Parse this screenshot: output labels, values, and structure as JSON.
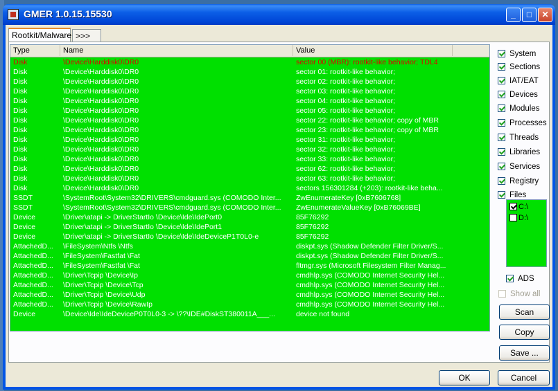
{
  "window": {
    "title": "GMER 1.0.15.15530",
    "minimize": "_",
    "maximize": "□",
    "close": "✕"
  },
  "tabs": [
    {
      "label": "Rootkit/Malware"
    },
    {
      "label": ">>>"
    }
  ],
  "columns": {
    "type": "Type",
    "name": "Name",
    "value": "Value"
  },
  "rows": [
    {
      "type": "Disk",
      "name": "\\Device\\Harddisk0\\DR0",
      "value": "sector 00 (MBR): rootkit-like behavior; TDL4",
      "highlight": true
    },
    {
      "type": "Disk",
      "name": "\\Device\\Harddisk0\\DR0",
      "value": "sector 01: rootkit-like behavior;"
    },
    {
      "type": "Disk",
      "name": "\\Device\\Harddisk0\\DR0",
      "value": "sector 02: rootkit-like behavior;"
    },
    {
      "type": "Disk",
      "name": "\\Device\\Harddisk0\\DR0",
      "value": "sector 03: rootkit-like behavior;"
    },
    {
      "type": "Disk",
      "name": "\\Device\\Harddisk0\\DR0",
      "value": "sector 04: rootkit-like behavior;"
    },
    {
      "type": "Disk",
      "name": "\\Device\\Harddisk0\\DR0",
      "value": "sector 05: rootkit-like behavior;"
    },
    {
      "type": "Disk",
      "name": "\\Device\\Harddisk0\\DR0",
      "value": "sector 22: rootkit-like behavior; copy of MBR"
    },
    {
      "type": "Disk",
      "name": "\\Device\\Harddisk0\\DR0",
      "value": "sector 23: rootkit-like behavior; copy of MBR"
    },
    {
      "type": "Disk",
      "name": "\\Device\\Harddisk0\\DR0",
      "value": "sector 31: rootkit-like behavior;"
    },
    {
      "type": "Disk",
      "name": "\\Device\\Harddisk0\\DR0",
      "value": "sector 32: rootkit-like behavior;"
    },
    {
      "type": "Disk",
      "name": "\\Device\\Harddisk0\\DR0",
      "value": "sector 33: rootkit-like behavior;"
    },
    {
      "type": "Disk",
      "name": "\\Device\\Harddisk0\\DR0",
      "value": "sector 62: rootkit-like behavior;"
    },
    {
      "type": "Disk",
      "name": "\\Device\\Harddisk0\\DR0",
      "value": "sector 63: rootkit-like behavior;"
    },
    {
      "type": "Disk",
      "name": "\\Device\\Harddisk0\\DR0",
      "value": "sectors 156301284 (+203): rootkit-like beha..."
    },
    {
      "type": "SSDT",
      "name": "\\SystemRoot\\System32\\DRIVERS\\cmdguard.sys (COMODO Inter...",
      "value": "ZwEnumerateKey [0xB7606768]"
    },
    {
      "type": "SSDT",
      "name": "\\SystemRoot\\System32\\DRIVERS\\cmdguard.sys (COMODO Inter...",
      "value": "ZwEnumerateValueKey [0xB76069BE]"
    },
    {
      "type": "Device",
      "name": "\\Driver\\atapi -> DriverStartIo \\Device\\Ide\\IdePort0",
      "value": "85F76292"
    },
    {
      "type": "Device",
      "name": "\\Driver\\atapi -> DriverStartIo \\Device\\Ide\\IdePort1",
      "value": "85F76292"
    },
    {
      "type": "Device",
      "name": "\\Driver\\atapi -> DriverStartIo \\Device\\Ide\\IdeDeviceP1T0L0-e",
      "value": "85F76292"
    },
    {
      "type": "AttachedD...",
      "name": "\\FileSystem\\Ntfs \\Ntfs",
      "value": "diskpt.sys (Shadow Defender Filter Driver/S..."
    },
    {
      "type": "AttachedD...",
      "name": "\\FileSystem\\Fastfat \\Fat",
      "value": "diskpt.sys (Shadow Defender Filter Driver/S..."
    },
    {
      "type": "AttachedD...",
      "name": "\\FileSystem\\Fastfat \\Fat",
      "value": "fltmgr.sys (Microsoft Filesystem Filter Manag..."
    },
    {
      "type": "AttachedD...",
      "name": "\\Driver\\Tcpip \\Device\\Ip",
      "value": "cmdhlp.sys (COMODO Internet Security Hel..."
    },
    {
      "type": "AttachedD...",
      "name": "\\Driver\\Tcpip \\Device\\Tcp",
      "value": "cmdhlp.sys (COMODO Internet Security Hel..."
    },
    {
      "type": "AttachedD...",
      "name": "\\Driver\\Tcpip \\Device\\Udp",
      "value": "cmdhlp.sys (COMODO Internet Security Hel..."
    },
    {
      "type": "AttachedD...",
      "name": "\\Driver\\Tcpip \\Device\\RawIp",
      "value": "cmdhlp.sys (COMODO Internet Security Hel..."
    },
    {
      "type": "Device",
      "name": "\\Device\\Ide\\IdeDeviceP0T0L0-3 -> \\??\\IDE#DiskST380011A___...",
      "value": "device not found"
    }
  ],
  "options": [
    {
      "label": "System",
      "checked": true
    },
    {
      "label": "Sections",
      "checked": true
    },
    {
      "label": "IAT/EAT",
      "checked": true
    },
    {
      "label": "Devices",
      "checked": true
    },
    {
      "label": "Modules",
      "checked": true
    },
    {
      "label": "Processes",
      "checked": true
    },
    {
      "label": "Threads",
      "checked": true
    },
    {
      "label": "Libraries",
      "checked": true
    },
    {
      "label": "Services",
      "checked": true
    },
    {
      "label": "Registry",
      "checked": true
    },
    {
      "label": "Files",
      "checked": true
    }
  ],
  "drives": [
    {
      "label": "C:\\",
      "checked": true
    },
    {
      "label": "D:\\",
      "checked": false
    }
  ],
  "ads": {
    "label": "ADS",
    "checked": true
  },
  "show_all": {
    "label": "Show all",
    "checked": false,
    "disabled": true
  },
  "buttons": {
    "scan": "Scan",
    "copy": "Copy",
    "save": "Save ...",
    "ok": "OK",
    "cancel": "Cancel"
  },
  "colors": {
    "list_background": "#00e000",
    "normal_text": "#ffffff",
    "threat_text": "#e00000",
    "title_bar": "#0055e5"
  }
}
